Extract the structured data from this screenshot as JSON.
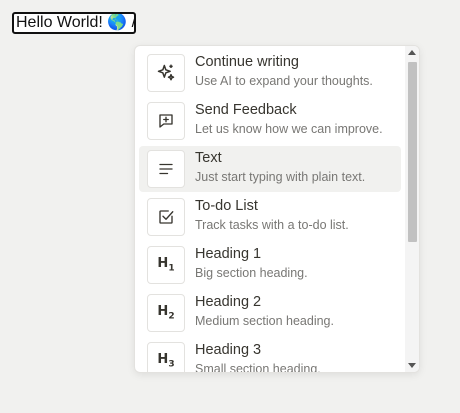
{
  "editor": {
    "text": "Hello World! 🌎 /"
  },
  "menu": {
    "items": [
      {
        "title": "Continue writing",
        "description": "Use AI to expand your thoughts.",
        "icon": "sparkles-icon"
      },
      {
        "title": "Send Feedback",
        "description": "Let us know how we can improve.",
        "icon": "message-square-plus-icon"
      },
      {
        "title": "Text",
        "description": "Just start typing with plain text.",
        "icon": "text-lines-icon",
        "selected": true
      },
      {
        "title": "To-do List",
        "description": "Track tasks with a to-do list.",
        "icon": "checkbox-icon"
      },
      {
        "title": "Heading 1",
        "description": "Big section heading.",
        "icon": "heading-1-icon",
        "glyph": "H",
        "level": "1"
      },
      {
        "title": "Heading 2",
        "description": "Medium section heading.",
        "icon": "heading-2-icon",
        "glyph": "H",
        "level": "2"
      },
      {
        "title": "Heading 3",
        "description": "Small section heading.",
        "icon": "heading-3-icon",
        "glyph": "H",
        "level": "3"
      }
    ]
  },
  "colors": {
    "background": "#f1f1ef",
    "selected_item": "#f1f1ef",
    "text": "#37352f",
    "muted_text": "#787774"
  }
}
